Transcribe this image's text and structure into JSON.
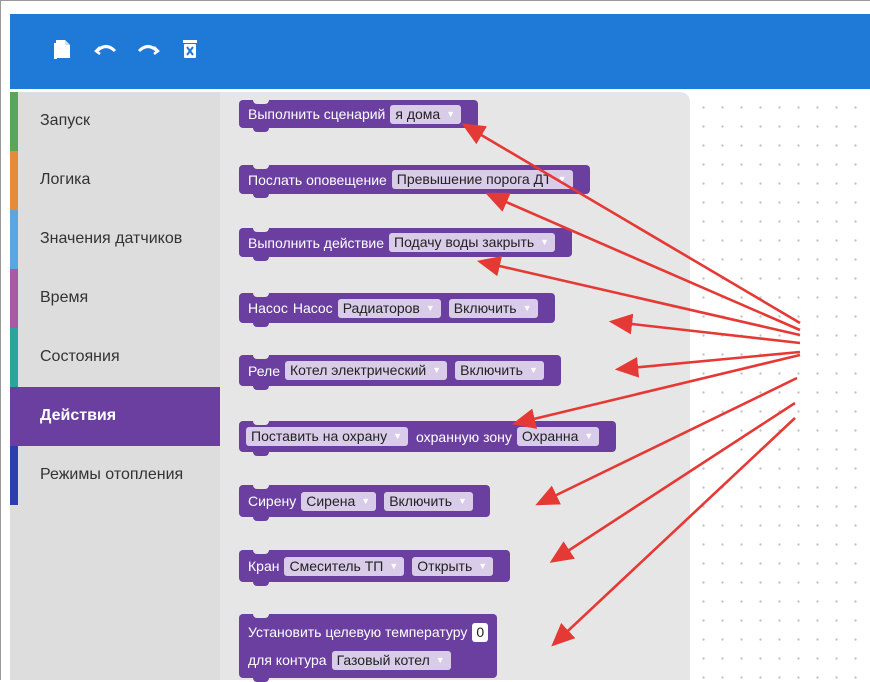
{
  "toolbar": {
    "icons": [
      "copy-icon",
      "undo-icon",
      "redo-icon",
      "delete-icon"
    ]
  },
  "categories": [
    {
      "label": "Запуск",
      "color": "#5ba55b"
    },
    {
      "label": "Логика",
      "color": "#e68a3a"
    },
    {
      "label": "Значения датчиков",
      "color": "#5ba5e0"
    },
    {
      "label": "Время",
      "color": "#a55ba5"
    },
    {
      "label": "Состояния",
      "color": "#2aa59a"
    },
    {
      "label": "Действия",
      "color": "#6a3fa0",
      "selected": true
    },
    {
      "label": "Режимы отопления",
      "color": "#2c3fb0"
    }
  ],
  "blocks": {
    "b1": {
      "text": "Выполнить сценарий",
      "dd": "я дома"
    },
    "b2": {
      "text": "Послать оповещение",
      "dd": "Превышение порога ДТ"
    },
    "b3": {
      "text": "Выполнить действие",
      "dd": "Подачу воды закрыть"
    },
    "b4": {
      "text": "Насос",
      "text2": "Насос",
      "dd1": "Радиаторов",
      "dd2": "Включить"
    },
    "b5": {
      "text": "Реле",
      "dd1": "Котел электрический",
      "dd2": "Включить"
    },
    "b6": {
      "dd1": "Поставить на охрану",
      "text": "охранную зону",
      "dd2": "Охранна"
    },
    "b7": {
      "text": "Сирену",
      "dd1": "Сирена",
      "dd2": "Включить"
    },
    "b8": {
      "text": "Кран",
      "dd1": "Смеситель ТП",
      "dd2": "Открыть"
    },
    "b9": {
      "text1": "Установить целевую температуру",
      "value": "0",
      "text2": "для контура",
      "dd": "Газовый котел"
    }
  },
  "colors": {
    "accent": "#1e7ad6",
    "block": "#6a3fa0",
    "arrow": "#e53935"
  }
}
